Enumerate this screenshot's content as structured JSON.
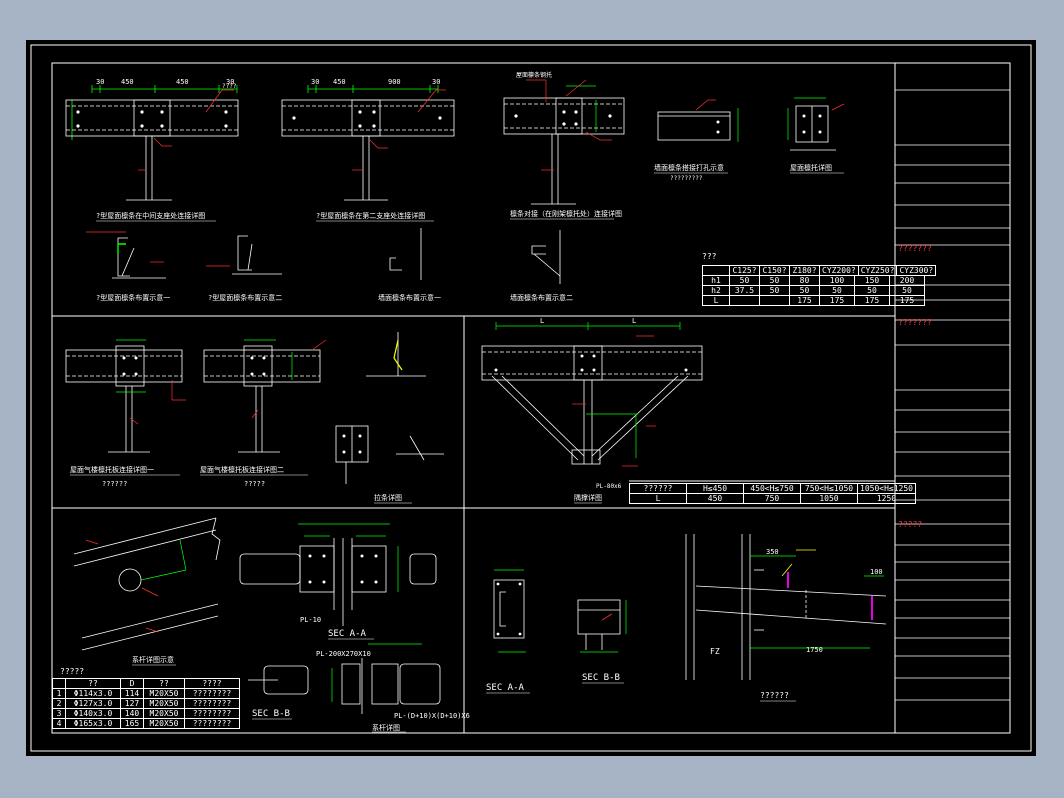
{
  "colors": {
    "background": "#a6b3c4",
    "canvas": "#000000",
    "line": "#ffffff",
    "dim": "#00ff00",
    "leader": "#ff3030",
    "note": "#ffff00",
    "accent": "#ff00ff"
  },
  "details": {
    "d1": {
      "title": "?型屋面檩条在中间支座处连接详图",
      "dims": [
        "30",
        "450",
        "450",
        "30"
      ],
      "note": "????"
    },
    "d2": {
      "title": "?型屋面檩条在第二支座处连接详图",
      "dims": [
        "30",
        "450",
        "900",
        "30"
      ]
    },
    "d3": {
      "title": "檩条对接（在刚架檩托处）连接详图",
      "note": "屋面檩条钢托"
    },
    "d4": {
      "title": "墙面檩条搭接打孔示意",
      "sub": "?????????"
    },
    "d5": {
      "title": "屋面檩托详图"
    },
    "c1": {
      "title": "?型屋面檩条布置示意一"
    },
    "c2": {
      "title": "?型屋面檩条布置示意二"
    },
    "c3": {
      "title": "墙面檩条布置示意一"
    },
    "c4": {
      "title": "墙面檩条布置示意二"
    },
    "m1": {
      "title": "屋面气楼檩托板连接详图一",
      "sub": "??????"
    },
    "m2": {
      "title": "屋面气楼檩托板连接详图二",
      "sub": "?????"
    },
    "m3": {
      "title": "拉条详图"
    },
    "br": {
      "title": "隅撑详图",
      "dims": [
        "L",
        "L"
      ],
      "plate": "PL-80x6"
    },
    "b1": {
      "title": "系杆详图示意"
    },
    "b2": {
      "title": "系杆详图",
      "sec_aa": "SEC A-A",
      "sec_bb": "SEC B-B",
      "plates": [
        "PL-10",
        "PL-200X270X10",
        "PL-(D+10)X(D+10)X6"
      ]
    },
    "b3": {
      "sec_aa": "SEC A-A",
      "sec_bb": "SEC B-B"
    },
    "b4": {
      "title": "??????",
      "dims": [
        "350",
        "1750",
        "100"
      ],
      "label": "FZ"
    }
  },
  "purlin_table": {
    "title": "???",
    "header": [
      "",
      "C125?",
      "C150?",
      "Z180?",
      "CYZ200?",
      "CYZ250?",
      "CYZ300?"
    ],
    "rows": [
      [
        "h1",
        "50",
        "50",
        "80",
        "100",
        "150",
        "200"
      ],
      [
        "h2",
        "37.5",
        "50",
        "50",
        "50",
        "50",
        "50"
      ],
      [
        "L",
        "",
        "",
        "175",
        "175",
        "175",
        "175"
      ]
    ]
  },
  "brace_table": {
    "header": [
      "??????",
      "H≤450",
      "450<H≤750",
      "750<H≤1050",
      "1050<H≤1250"
    ],
    "row": [
      "L",
      "450",
      "750",
      "1050",
      "1250"
    ]
  },
  "tie_table": {
    "title": "?????",
    "header": [
      "",
      "??",
      "D",
      "??",
      "????"
    ],
    "rows": [
      [
        "1",
        "Φ114x3.0",
        "114",
        "M20X50",
        "????????"
      ],
      [
        "2",
        "Φ127x3.0",
        "127",
        "M20X50",
        "????????"
      ],
      [
        "3",
        "Φ140x3.0",
        "140",
        "M20X50",
        "????????"
      ],
      [
        "4",
        "Φ165x3.0",
        "165",
        "M20X50",
        "????????"
      ]
    ]
  },
  "title_block": {
    "notes": [
      "???????",
      "???????",
      "?????"
    ]
  }
}
